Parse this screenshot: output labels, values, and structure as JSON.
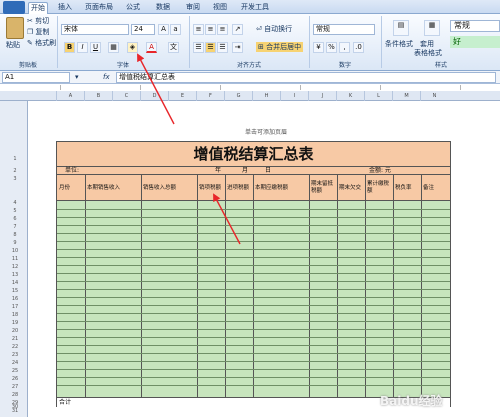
{
  "ribbon_tabs": [
    "开始",
    "插入",
    "页面布局",
    "公式",
    "数据",
    "审阅",
    "视图",
    "开发工具"
  ],
  "clipboard": {
    "paste": "粘贴",
    "cut": "剪切",
    "copy": "复制",
    "format_painter": "格式刷",
    "group": "剪贴板"
  },
  "font": {
    "name": "宋体",
    "size": "24",
    "bold": "B",
    "italic": "I",
    "underline": "U",
    "group": "字体"
  },
  "alignment": {
    "wrap": "自动换行",
    "merge": "合并后居中",
    "group": "对齐方式"
  },
  "number": {
    "format": "常规",
    "group": "数字"
  },
  "styles": {
    "conditional": "条件格式",
    "table_format_1": "套用",
    "table_format_2": "表格格式",
    "normal": "常规",
    "good": "好",
    "group": "样式"
  },
  "formula_bar": {
    "cell_ref": "A1",
    "fx": "fx",
    "content": "增值税结算汇总表"
  },
  "columns": [
    "A",
    "B",
    "C",
    "D",
    "E",
    "F",
    "G",
    "H",
    "I",
    "J",
    "K",
    "L",
    "M",
    "N"
  ],
  "row_numbers": [
    "1",
    "2",
    "3",
    "4",
    "5",
    "6",
    "7",
    "8",
    "9",
    "10",
    "11",
    "12",
    "13",
    "14",
    "15",
    "16",
    "17",
    "18",
    "19",
    "20",
    "21",
    "22",
    "23",
    "24",
    "25",
    "26",
    "27",
    "28",
    "29",
    "30",
    "31"
  ],
  "page_hint": "单击可添加页眉",
  "sheet": {
    "title": "增值税结算汇总表",
    "unit_label": "单位:",
    "year": "年",
    "month": "月",
    "day": "日",
    "amount_unit": "金额: 元",
    "headers": [
      "月份",
      "本期销售收入",
      "销售收入总额",
      "销项税额",
      "进项税额",
      "本期应缴税额",
      "期末留抵税额",
      "期末欠交",
      "累计缴税额",
      "税负率",
      "备注"
    ],
    "total_label": "合计"
  },
  "watermark": "Baidu经验",
  "colors": {
    "title_fill": "#f7c9a5",
    "body_fill": "#c7e5bd",
    "arrow": "#e8262a"
  }
}
